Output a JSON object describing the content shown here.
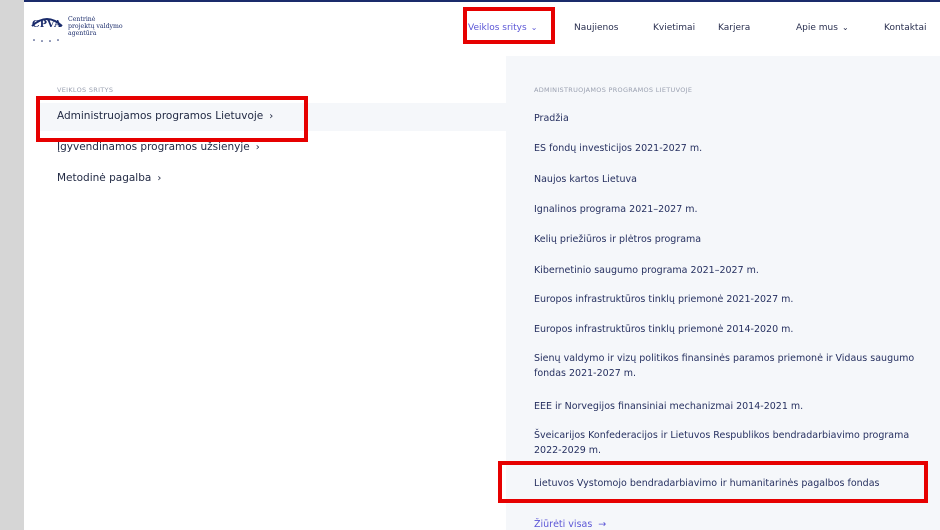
{
  "logo": {
    "abbr": "CPVA",
    "line1": "Centrinė",
    "line2": "projektų valdymo",
    "line3": "agentūra"
  },
  "nav": {
    "items": [
      {
        "label": "Veiklos sritys",
        "chevron": "⌄"
      },
      {
        "label": "Naujienos"
      },
      {
        "label": "Kvietimai"
      },
      {
        "label": "Karjera"
      },
      {
        "label": "Apie mus",
        "chevron": "⌄"
      },
      {
        "label": "Kontaktai"
      }
    ]
  },
  "left": {
    "section_label": "VEIKLOS SRITYS",
    "items": [
      {
        "label": "Administruojamos programos Lietuvoje",
        "arrow": "›"
      },
      {
        "label": "Įgyvendinamos programos užsienyje",
        "arrow": "›"
      },
      {
        "label": "Metodinė pagalba",
        "arrow": "›"
      }
    ]
  },
  "right": {
    "section_label": "ADMINISTRUOJAMOS PROGRAMOS LIETUVOJE",
    "items": [
      "Pradžia",
      "ES fondų investicijos 2021-2027 m.",
      "Naujos kartos Lietuva",
      "Ignalinos programa 2021–2027 m.",
      "Kelių priežiūros ir plėtros programa",
      "Kibernetinio saugumo programa 2021–2027 m.",
      "Europos infrastruktūros tinklų priemonė 2021-2027 m.",
      "Europos infrastruktūros tinklų priemonė 2014-2020 m.",
      "Sienų valdymo ir vizų politikos finansinės paramos priemonė ir Vidaus saugumo fondas 2021-2027 m.",
      "EEE ir Norvegijos finansiniai mechanizmai 2014-2021 m.",
      "Šveicarijos Konfederacijos ir Lietuvos Respublikos bendradarbiavimo programa 2022-2029 m.",
      "Lietuvos Vystomojo bendradarbiavimo ir humanitarinės pagalbos fondas"
    ],
    "view_all": "Žiūrėti visas",
    "view_all_arrow": "→"
  },
  "colors": {
    "accent": "#5b56d6",
    "highlight": "#e60000",
    "brand": "#1a2b6b"
  }
}
